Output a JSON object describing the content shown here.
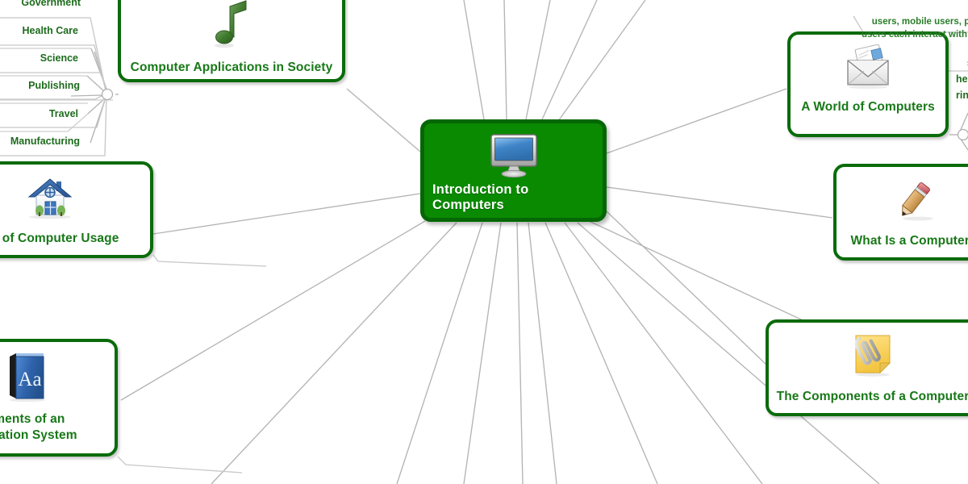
{
  "map": {
    "title": "Introduction to Computers",
    "accent_green": "#0a8a00",
    "border_green": "#046704",
    "node_border": "#0a6b0a",
    "text_green": "#187818",
    "edge_color": "#b4b4b4",
    "background": "#ffffff"
  },
  "root": {
    "label": "Introduction to Computers",
    "icon": "monitor-icon"
  },
  "branches": [
    {
      "id": "computer-applications-in-society",
      "label": "Computer Applications in Society",
      "icon": "music-note-icon"
    },
    {
      "id": "a-world-of-computers",
      "label": "A World of Computers",
      "icon": "envelope-icon"
    },
    {
      "id": "what-is-a-computer",
      "label": "What Is a Computer?",
      "icon": "pencil-icon"
    },
    {
      "id": "the-components-of-a-computer",
      "label": "The Components of a Computer",
      "icon": "sticky-note-icon"
    },
    {
      "id": "examples-of-computer-usage",
      "label": "les of Computer Usage",
      "icon": "house-icon"
    },
    {
      "id": "elements-of-an-information-system",
      "label": "ements of an\normation System",
      "icon": "dictionary-book-icon"
    }
  ],
  "sub_branches": {
    "parent": "computer-applications-in-society",
    "items": [
      {
        "label": "Government"
      },
      {
        "label": "Health Care"
      },
      {
        "label": "Science"
      },
      {
        "label": "Publishing"
      },
      {
        "label": "Travel"
      },
      {
        "label": "Manufacturing"
      }
    ]
  },
  "annotations": [
    {
      "id": "world-of-computers-note",
      "text": "users, mobile users, power\nusers each interact with co"
    },
    {
      "id": "right-edge-note",
      "text": "ses o\nhealt\nring"
    }
  ]
}
